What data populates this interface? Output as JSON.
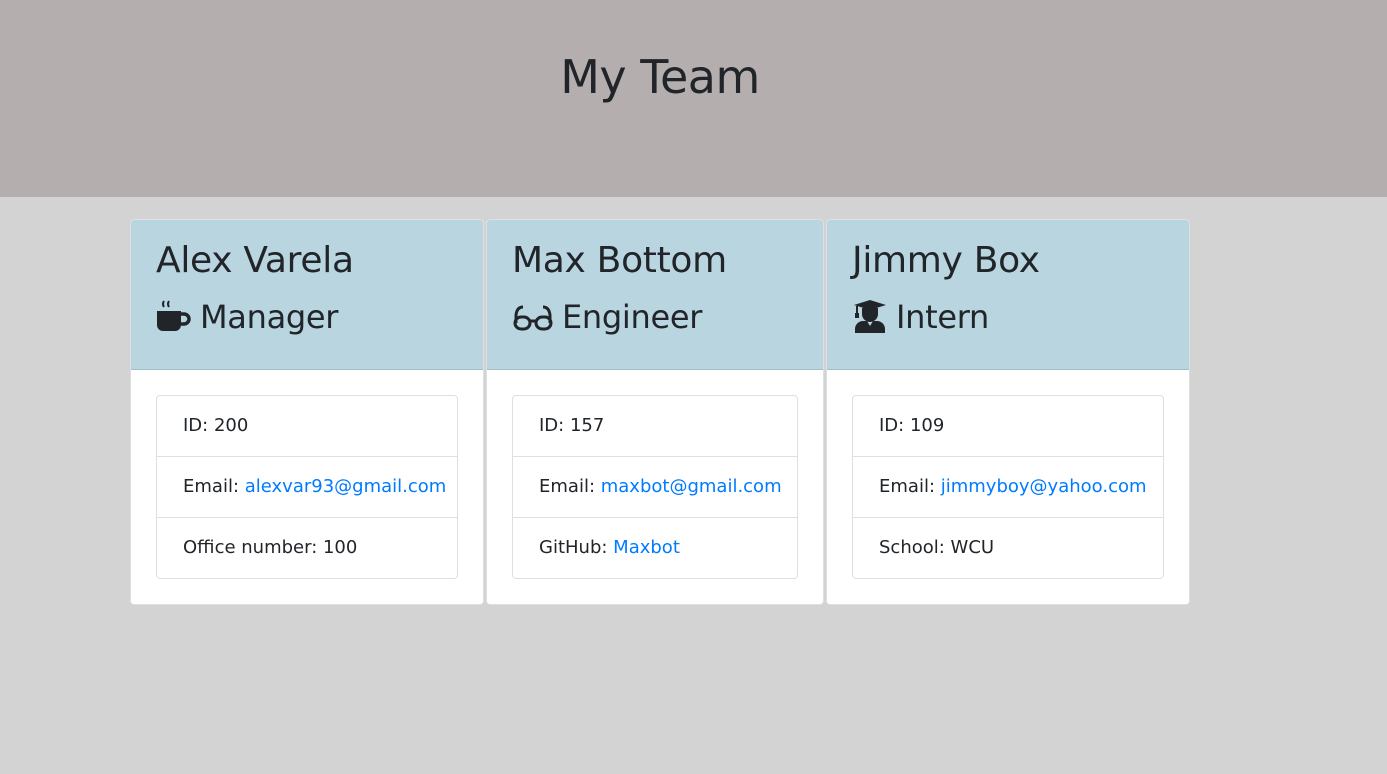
{
  "header": {
    "title": "My Team"
  },
  "colors": {
    "jumbotron": "#b4aeae",
    "card_header": "#b8d5e0",
    "link": "#007bff"
  },
  "employees": [
    {
      "name": "Alex Varela",
      "role": "Manager",
      "icon": "mug-hot-icon",
      "id_label": "ID: 200",
      "email_label": "Email: ",
      "email": "alexvar93@gmail.com",
      "extra_label": "Office number: 100",
      "extra_link": ""
    },
    {
      "name": "Max Bottom",
      "role": "Engineer",
      "icon": "glasses-icon",
      "id_label": "ID: 157",
      "email_label": "Email: ",
      "email": "maxbot@gmail.com",
      "extra_label": "GitHub: ",
      "extra_link": "Maxbot"
    },
    {
      "name": "Jimmy Box",
      "role": "Intern",
      "icon": "user-graduate-icon",
      "id_label": "ID: 109",
      "email_label": "Email: ",
      "email": "jimmyboy@yahoo.com",
      "extra_label": "School: WCU",
      "extra_link": ""
    }
  ]
}
